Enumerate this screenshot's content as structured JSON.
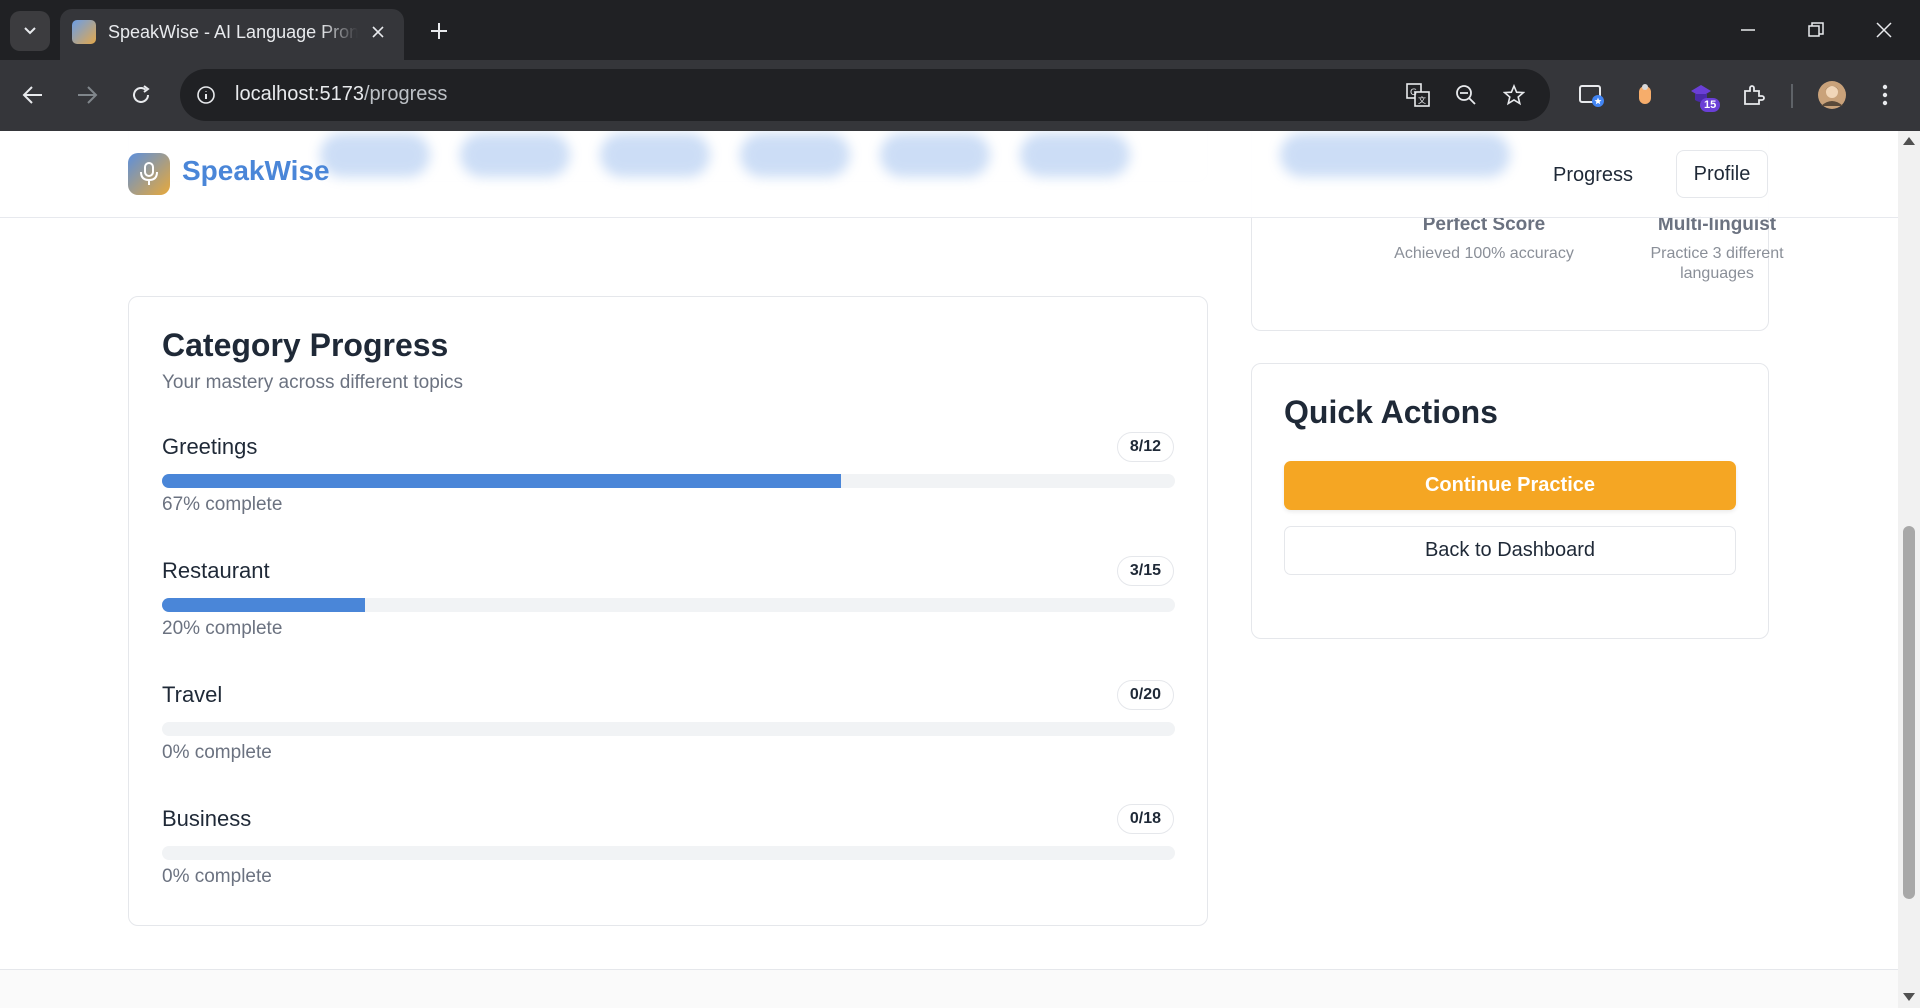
{
  "browser": {
    "tab_title": "SpeakWise - AI Language Pronunciation",
    "url_host": "localhost:5173",
    "url_path": "/progress",
    "extension_badge": "15"
  },
  "header": {
    "logo_text": "SpeakWise",
    "nav_progress": "Progress",
    "nav_profile": "Profile"
  },
  "categories": {
    "title": "Category Progress",
    "subtitle": "Your mastery across different topics",
    "items": [
      {
        "name": "Greetings",
        "count": "8/12",
        "percent": 67,
        "percent_label": "67% complete"
      },
      {
        "name": "Restaurant",
        "count": "3/15",
        "percent": 20,
        "percent_label": "20% complete"
      },
      {
        "name": "Travel",
        "count": "0/20",
        "percent": 0,
        "percent_label": "0% complete"
      },
      {
        "name": "Business",
        "count": "0/18",
        "percent": 0,
        "percent_label": "0% complete"
      }
    ]
  },
  "achievements": [
    {
      "name": "Perfect Score",
      "desc": "Achieved 100% accuracy"
    },
    {
      "name": "Multi-linguist",
      "desc": "Practice 3 different languages"
    }
  ],
  "quick_actions": {
    "title": "Quick Actions",
    "continue_label": "Continue Practice",
    "dashboard_label": "Back to Dashboard"
  },
  "colors": {
    "brand_blue": "#4a86d8",
    "accent_orange": "#f5a623"
  }
}
